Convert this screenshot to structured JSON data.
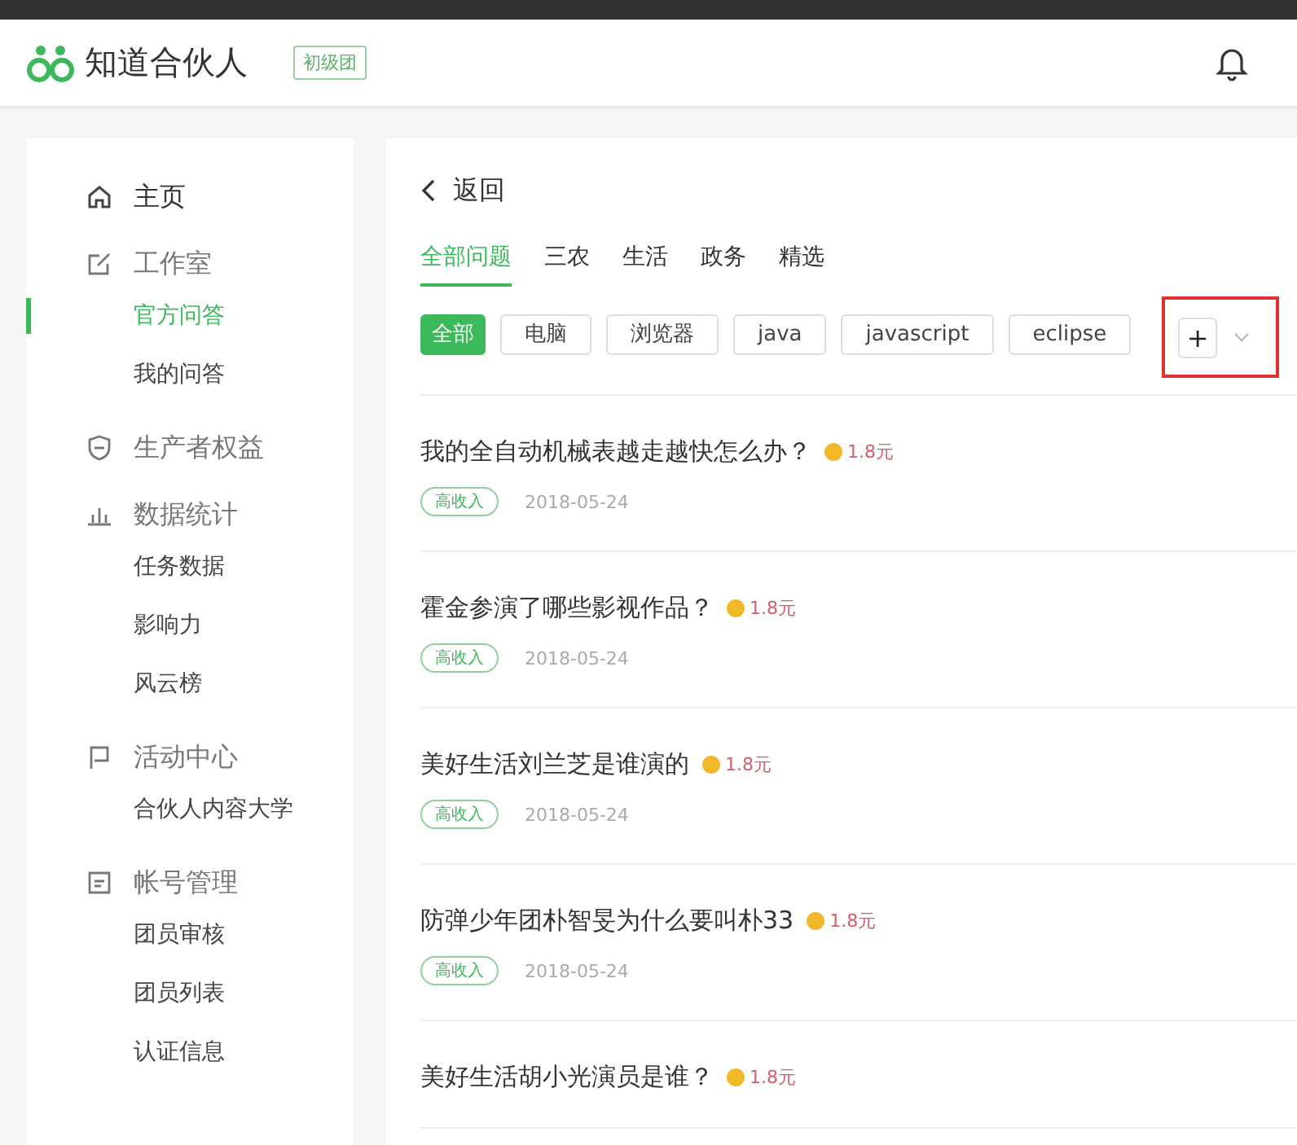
{
  "header": {
    "logo_text": "知道合伙人",
    "level_badge": "初级团"
  },
  "sidebar": {
    "items": [
      {
        "label": "主页",
        "selected": false
      },
      {
        "label": "工作室",
        "selected": false,
        "children": [
          {
            "label": "官方问答",
            "selected": true
          },
          {
            "label": "我的问答",
            "selected": false
          }
        ]
      },
      {
        "label": "生产者权益",
        "selected": false
      },
      {
        "label": "数据统计",
        "selected": false,
        "children": [
          {
            "label": "任务数据",
            "selected": false
          },
          {
            "label": "影响力",
            "selected": false
          },
          {
            "label": "风云榜",
            "selected": false
          }
        ]
      },
      {
        "label": "活动中心",
        "selected": false,
        "children": [
          {
            "label": "合伙人内容大学",
            "selected": false
          }
        ]
      },
      {
        "label": "帐号管理",
        "selected": false,
        "children": [
          {
            "label": "团员审核",
            "selected": false
          },
          {
            "label": "团员列表",
            "selected": false
          },
          {
            "label": "认证信息",
            "selected": false
          }
        ]
      }
    ]
  },
  "back_link": "返回",
  "tabs": [
    {
      "label": "全部问题",
      "selected": true
    },
    {
      "label": "三农",
      "selected": false
    },
    {
      "label": "生活",
      "selected": false
    },
    {
      "label": "政务",
      "selected": false
    },
    {
      "label": "精选",
      "selected": false
    }
  ],
  "filters": [
    {
      "label": "全部",
      "selected": true
    },
    {
      "label": "电脑",
      "selected": false
    },
    {
      "label": "浏览器",
      "selected": false
    },
    {
      "label": "java",
      "selected": false
    },
    {
      "label": "javascript",
      "selected": false
    },
    {
      "label": "eclipse",
      "selected": false
    }
  ],
  "add_filter": "+",
  "questions": [
    {
      "title": "我的全自动机械表越走越快怎么办？",
      "reward": "1.8元",
      "tag": "高收入",
      "date": "2018-05-24"
    },
    {
      "title": "霍金参演了哪些影视作品？",
      "reward": "1.8元",
      "tag": "高收入",
      "date": "2018-05-24"
    },
    {
      "title": "美好生活刘兰芝是谁演的",
      "reward": "1.8元",
      "tag": "高收入",
      "date": "2018-05-24"
    },
    {
      "title": "防弹少年团朴智旻为什么要叫朴33",
      "reward": "1.8元",
      "tag": "高收入",
      "date": "2018-05-24"
    },
    {
      "title": "美好生活胡小光演员是谁？",
      "reward": "1.8元"
    }
  ]
}
